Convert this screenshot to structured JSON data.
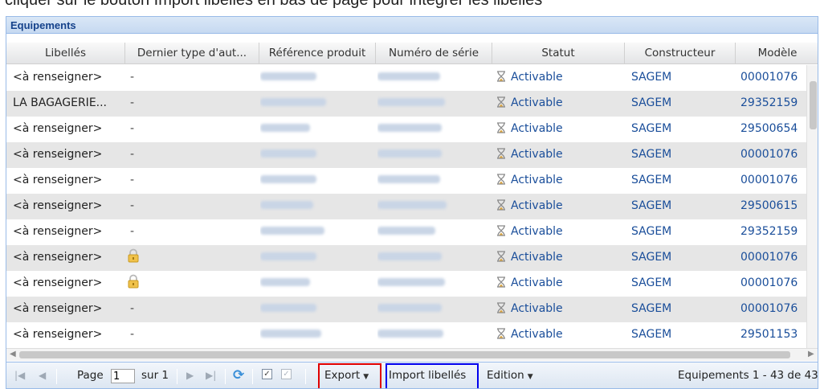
{
  "colors": {
    "header_title": "#15428b",
    "link_blue": "#1a4e9a",
    "export_highlight": "#e00000",
    "import_highlight": "#0000ee",
    "alt_row": "#e6e6e6"
  },
  "panel": {
    "title": "Equipements"
  },
  "columns": [
    "Libellés",
    "Dernier type d'aut...",
    "Référence produit",
    "Numéro de série",
    "Statut",
    "Constructeur",
    "Modèle"
  ],
  "rows": [
    {
      "libelle": "<à renseigner>",
      "dernier": "-",
      "lock": false,
      "statut": "Activable",
      "constructeur": "SAGEM",
      "modele": "00001076"
    },
    {
      "libelle": "LA BAGAGERIE...",
      "dernier": "-",
      "lock": false,
      "statut": "Activable",
      "constructeur": "SAGEM",
      "modele": "29352159"
    },
    {
      "libelle": "<à renseigner>",
      "dernier": "-",
      "lock": false,
      "statut": "Activable",
      "constructeur": "SAGEM",
      "modele": "29500654"
    },
    {
      "libelle": "<à renseigner>",
      "dernier": "-",
      "lock": false,
      "statut": "Activable",
      "constructeur": "SAGEM",
      "modele": "00001076"
    },
    {
      "libelle": "<à renseigner>",
      "dernier": "-",
      "lock": false,
      "statut": "Activable",
      "constructeur": "SAGEM",
      "modele": "00001076"
    },
    {
      "libelle": "<à renseigner>",
      "dernier": "-",
      "lock": false,
      "statut": "Activable",
      "constructeur": "SAGEM",
      "modele": "29500615"
    },
    {
      "libelle": "<à renseigner>",
      "dernier": "-",
      "lock": false,
      "statut": "Activable",
      "constructeur": "SAGEM",
      "modele": "29352159"
    },
    {
      "libelle": "<à renseigner>",
      "dernier": "",
      "lock": true,
      "statut": "Activable",
      "constructeur": "SAGEM",
      "modele": "00001076"
    },
    {
      "libelle": "<à renseigner>",
      "dernier": "",
      "lock": true,
      "statut": "Activable",
      "constructeur": "SAGEM",
      "modele": "00001076"
    },
    {
      "libelle": "<à renseigner>",
      "dernier": "-",
      "lock": false,
      "statut": "Activable",
      "constructeur": "SAGEM",
      "modele": "00001076"
    },
    {
      "libelle": "<à renseigner>",
      "dernier": "-",
      "lock": false,
      "statut": "Activable",
      "constructeur": "SAGEM",
      "modele": "29501153"
    }
  ],
  "icons": {
    "status": "hourglass-icon",
    "locked": "lock-icon",
    "refresh": "refresh-icon"
  },
  "toolbar": {
    "page_label": "Page",
    "page_value": "1",
    "of_label": "sur 1",
    "export_label": "Export",
    "import_label": "Import libellés",
    "edition_label": "Edition",
    "summary": "Equipements 1 - 43 de 43"
  }
}
